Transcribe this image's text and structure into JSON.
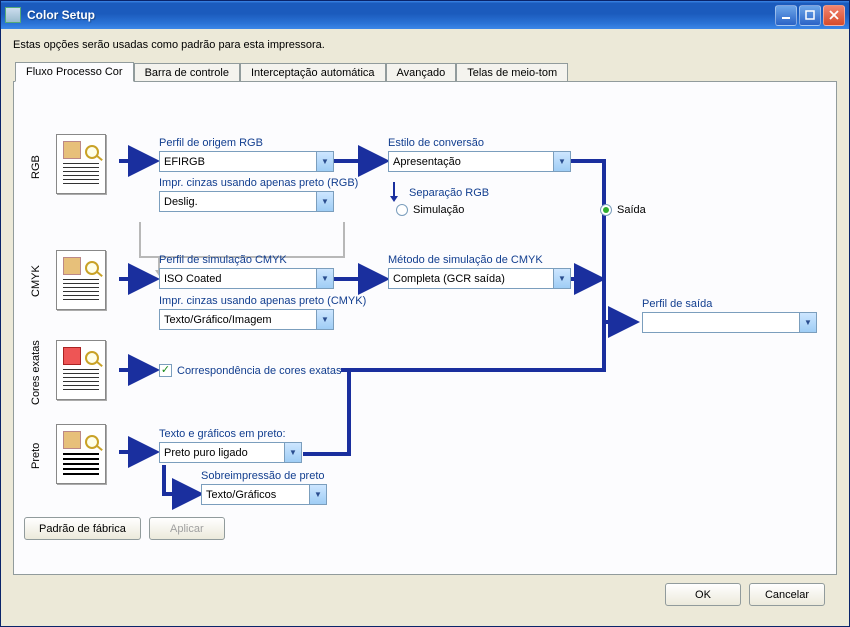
{
  "window": {
    "title": "Color Setup"
  },
  "description": "Estas opções serão usadas como padrão para esta impressora.",
  "tabs": [
    {
      "label": "Fluxo Processo Cor",
      "active": true
    },
    {
      "label": "Barra de controle"
    },
    {
      "label": "Interceptação automática"
    },
    {
      "label": "Avançado"
    },
    {
      "label": "Telas de meio-tom"
    }
  ],
  "sections": {
    "rgb": {
      "name": "RGB"
    },
    "cmyk": {
      "name": "CMYK"
    },
    "spot": {
      "name": "Cores exatas"
    },
    "black": {
      "name": "Preto"
    }
  },
  "fields": {
    "rgb_source": {
      "label": "Perfil de origem RGB",
      "value": "EFIRGB"
    },
    "rendering_style": {
      "label": "Estilo de conversão",
      "value": "Apresentação"
    },
    "print_gray_rgb": {
      "label": "Impr. cinzas usando apenas preto (RGB)",
      "value": "Deslig."
    },
    "rgb_separation": {
      "label": "Separação RGB"
    },
    "simulation_radio": {
      "label": "Simulação",
      "selected": false
    },
    "output_radio": {
      "label": "Saída",
      "selected": true
    },
    "cmyk_sim_profile": {
      "label": "Perfil de simulação CMYK",
      "value": "ISO Coated"
    },
    "cmyk_sim_method": {
      "label": "Método de simulação de CMYK",
      "value": "Completa (GCR saída)"
    },
    "print_gray_cmyk": {
      "label": "Impr. cinzas usando apenas preto (CMYK)",
      "value": "Texto/Gráfico/Imagem"
    },
    "spot_match": {
      "label": "Correspondência de cores exatas",
      "checked": true
    },
    "black_textgfx": {
      "label": "Texto e gráficos em preto:",
      "value": "Preto puro ligado"
    },
    "black_overprint": {
      "label": "Sobreimpressão de preto",
      "value": "Texto/Gráficos"
    },
    "output_profile": {
      "label": "Perfil de saída",
      "value": ""
    }
  },
  "buttons": {
    "factory_default": "Padrão de fábrica",
    "apply": "Aplicar",
    "ok": "OK",
    "cancel": "Cancelar"
  },
  "colors": {
    "arrow": "#1a2f9e",
    "label": "#123e8f"
  }
}
